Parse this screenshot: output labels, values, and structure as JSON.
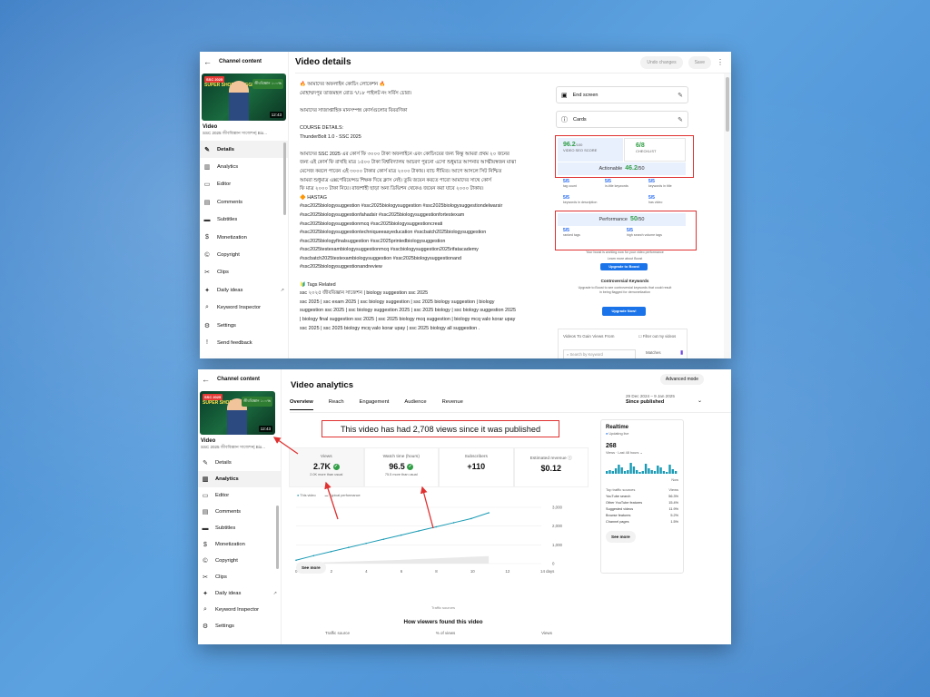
{
  "colors": {
    "accent": "#1a73e8",
    "highlight_border": "#e03131",
    "success": "#2f9e44"
  },
  "sidebar": {
    "header": "Channel content",
    "thumb": {
      "badge": "SSC 2025",
      "title": "SUPER SHORT SUGGESTION",
      "tag": "জীববিজ্ঞান ১০০%",
      "time": "12:43"
    },
    "video_label": "Video",
    "video_sub": "SSC 2025 জীববিজ্ঞান সাজেশন| Bio...",
    "items": [
      {
        "label": "Details",
        "icon": "pencil-icon"
      },
      {
        "label": "Analytics",
        "icon": "analytics-icon"
      },
      {
        "label": "Editor",
        "icon": "editor-icon"
      },
      {
        "label": "Comments",
        "icon": "comments-icon"
      },
      {
        "label": "Subtitles",
        "icon": "subtitles-icon"
      },
      {
        "label": "Monetization",
        "icon": "dollar-icon"
      },
      {
        "label": "Copyright",
        "icon": "copyright-icon"
      },
      {
        "label": "Clips",
        "icon": "scissors-icon"
      },
      {
        "label": "Daily ideas",
        "icon": "lightbulb-icon"
      },
      {
        "label": "Keyword Inspector",
        "icon": "magnifier-icon"
      },
      {
        "label": "Settings",
        "icon": "gear-icon"
      },
      {
        "label": "Send feedback",
        "icon": "feedback-icon"
      }
    ]
  },
  "details": {
    "title": "Video details",
    "undo": "Undo changes",
    "save": "Save",
    "description": [
      "🔥 আমাদের অফলাইন কোচিং লোকেশন 🔥",
      "মোহাম্মদপুর তাজমহল রোড ৭/১৮ পাইলট নং সর্বিস চোরা।",
      "",
      "আমাদের সাজাপ্তাহিক মানসম্পন্ন কোর্সগুলোর বিবরণিকা",
      "",
      "COURSE DETAILS:",
      "ThunderBolt 1.0 - SSC 2025",
      "",
      "আমাদের SSC 2025 এর কোর্স ফি ৩০০০ টাকা অফলাইনে এবং কোচিংয়ের জন্য কিন্তু আমরা প্রথম ২০ জনের",
      "জন্য এই কোর্স ফি রাখছি মাত্র ১৫০০ টাকা বিশ্ববিদ্যালয় আচরণ পুরনো এসো শুধুমাত্র আপনার আত্মীয়স্বজন মাঝা",
      "মেসেজ করলে পাবেন এই ৩০০০ টাকার কোর্স মাত্র ২০০০ টাকায়। ব্যাচ সীমিত। আগে আসলে সিট নিশ্চিত",
      "আমরা শুধুমাত্র এক্সপেরিয়েন্সড শিক্ষক দিয়ে ক্লাস নেই। তুমি জয়েন করতে পারো আমাদের সাথে কোর্স",
      "ফি মাত্র ২০০০ টাকা নিয়ে। রাজশাহী ছাড়া অন্য ডিভিশন থেকেও জয়েন করা যাবে ২০০০ টাকায়।",
      "🔶 HASTAG",
      "#ssc2025biologysuggestion #ssc2025biologysuggestion #ssc2025biologysuggestiondelwarsir",
      "#ssc2025biologysuggestionfahadsir #ssc2025biologysuggestionfortestexam",
      "#ssc2025biologysuggestionmcq #ssc2025biologysuggestioncreati",
      "#ssc2025biologysuggestiontechniqueeasyeducation #sscbatch2025biologysuggestion",
      "#ssc2025biologyfinalsuggestion #ssc2025printedbiologysuggestion",
      "#ssc2025testexambiologysuggestionmcq #sscbiologysuggestion2025rifatacademy",
      "#sscbatch2025testexambiologysuggestion #ssc2025biologysuggestionand",
      "#ssc2025biologysuggestionandreview",
      "",
      "🔰 Tags Related",
      "ssc ২০২৫ জীববিজ্ঞান সাজেশন | biology suggestion ssc 2025",
      "ssc 2025 | ssc exam 2025 | ssc biology suggestion | ssc 2025 biology suggestion | biology",
      "suggestion ssc 2025 | ssc biology suggestion 2025 | ssc 2025 biology | ssc biology suggestion 2025",
      "| biology final suggestion ssc 2025 | ssc 2025 biology mcq suggestion | biology mcq valo korar upay",
      "ssc 2025 | ssc 2025 biology mcq valo korar upay | ssc 2025 biology all suggestion ."
    ],
    "end_screen": "End screen",
    "cards": "Cards",
    "score": {
      "video_seo_value": "96.2",
      "video_seo_den": "/100",
      "video_seo_label": "VIDEO SEO SCORE",
      "checklist_value": "6/8",
      "checklist_label": "CHECKLIST",
      "actionable_label": "Actionable",
      "actionable_value": "46.2",
      "actionable_den": "/50"
    },
    "grid": [
      {
        "val": "5/5",
        "lbl": "tag count"
      },
      {
        "val": "5/5",
        "lbl": "in-title keywords"
      },
      {
        "val": "5/5",
        "lbl": "keywords in title"
      },
      {
        "val": "5/5",
        "lbl": "keywords in description"
      },
      {
        "val": "",
        "lbl": ""
      },
      {
        "val": "5/5",
        "lbl": "has video"
      }
    ],
    "performance": {
      "label": "Performance",
      "value": "50",
      "den": "/50",
      "a_val": "5/5",
      "a_lbl": "ranked tags",
      "b_val": "5/5",
      "b_lbl": "high search volume tags"
    },
    "boost_note": "Your boost is working now for your video performance",
    "learn_more": "Learn more about Boost",
    "upgrade_boost": "Upgrade to Boost",
    "controversial_title": "Controversial Keywords",
    "controversial_desc": "Upgrade to Boost to see controversial keywords that could result in being flagged for demonetization",
    "upgrade_now": "Upgrade Now!",
    "views_panel": "Videos To Gain Views From",
    "filter_label": "Filter out my videos",
    "search_placeholder": "Search by Keyword",
    "matches": "Matches"
  },
  "analytics": {
    "title": "Video analytics",
    "advanced": "Advanced mode",
    "tabs": [
      "Overview",
      "Reach",
      "Engagement",
      "Audience",
      "Revenue"
    ],
    "date_range": "29 Dec 2024 – 9 Jan 2025",
    "date_label": "Since published",
    "headline": "This video has had 2,708 views since it was published",
    "metrics": [
      {
        "label": "Views",
        "value": "2.7K",
        "sub": "2.0K more than usual",
        "check": true
      },
      {
        "label": "Watch time (hours)",
        "value": "96.5",
        "sub": "75.5 more than usual",
        "check": true
      },
      {
        "label": "Subscribers",
        "value": "+110",
        "sub": ""
      },
      {
        "label": "Estimated revenue",
        "value": "$0.12",
        "sub": ""
      }
    ],
    "legend": [
      "This video",
      "Typical performance"
    ],
    "x_ticks": [
      "0",
      "2",
      "4",
      "6",
      "8",
      "10",
      "12",
      "14 days"
    ],
    "y_ticks": [
      "3,000",
      "2,000",
      "1,000",
      "0"
    ],
    "see_more": "See more",
    "realtime": {
      "title": "Realtime",
      "live": "Updating live",
      "num": "268",
      "sub": "Views · Last 48 hours",
      "now": "Now",
      "top_sources": "Top traffic sources",
      "views_col": "Views",
      "sources": [
        {
          "name": "YouTube search",
          "pct": "56.3%"
        },
        {
          "name": "Other YouTube features",
          "pct": "15.4%"
        },
        {
          "name": "Suggested videos",
          "pct": "11.9%"
        },
        {
          "name": "Browse features",
          "pct": "5.2%"
        },
        {
          "name": "Channel pages",
          "pct": "1.5%"
        }
      ]
    },
    "traffic_hint": "Traffic sources",
    "how_found": "How viewers found this video",
    "found_cols": [
      "Traffic source",
      "% of views",
      "Views"
    ]
  },
  "chart_data": {
    "type": "line",
    "x": [
      0,
      1,
      2,
      3,
      4,
      5,
      6,
      7,
      8,
      9,
      10,
      11
    ],
    "series": [
      {
        "name": "This video",
        "values": [
          180,
          420,
          640,
          860,
          1080,
          1300,
          1520,
          1740,
          1960,
          2180,
          2400,
          2708
        ]
      },
      {
        "name": "Typical performance",
        "values": [
          0,
          40,
          80,
          110,
          140,
          170,
          200,
          240,
          280,
          320,
          360,
          400
        ]
      }
    ],
    "xlabel": "",
    "ylabel": "",
    "xlim": [
      0,
      14
    ],
    "ylim": [
      0,
      3000
    ],
    "x_ticks": [
      "0",
      "2",
      "4",
      "6",
      "8",
      "10",
      "12",
      "14 days"
    ],
    "y_ticks": [
      "0",
      "1,000",
      "2,000",
      "3,000"
    ],
    "legend": "top-left"
  }
}
